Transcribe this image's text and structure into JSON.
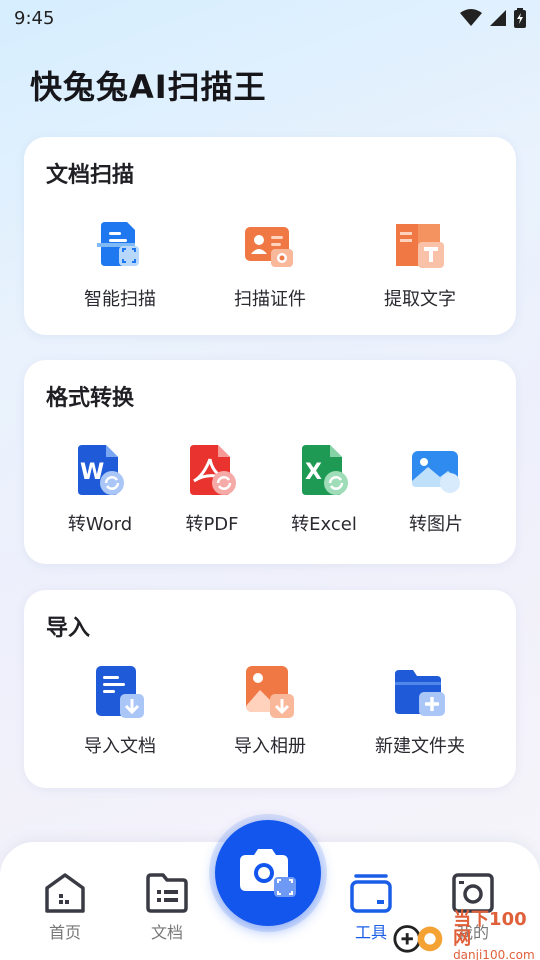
{
  "status": {
    "time": "9:45"
  },
  "app_title": "快兔兔AI扫描王",
  "sections": {
    "scan": {
      "title": "文档扫描",
      "items": [
        "智能扫描",
        "扫描证件",
        "提取文字"
      ]
    },
    "convert": {
      "title": "格式转换",
      "items": [
        "转Word",
        "转PDF",
        "转Excel",
        "转图片"
      ]
    },
    "import": {
      "title": "导入",
      "items": [
        "导入文档",
        "导入相册",
        "新建文件夹"
      ]
    }
  },
  "tabs": [
    "首页",
    "文档",
    "工具",
    "我的"
  ],
  "active_tab": "工具",
  "watermark": {
    "main": "当下100网",
    "sub": "danji100.com"
  },
  "colors": {
    "accent": "#1356ee",
    "word": "#1f5bd8",
    "pdf": "#e8332e",
    "excel": "#1f9a55",
    "orange": "#f07844"
  }
}
